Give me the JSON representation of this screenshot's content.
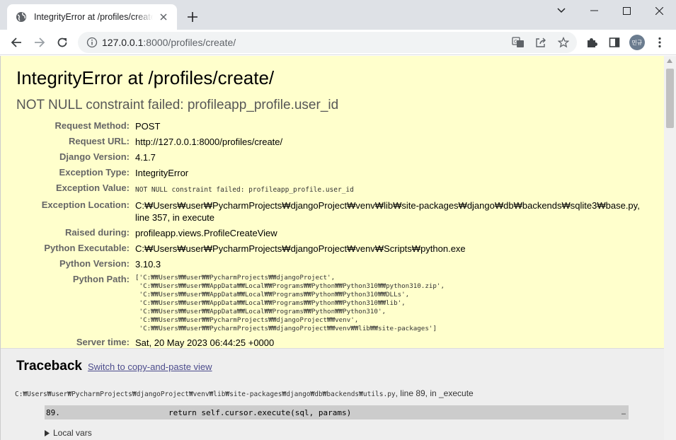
{
  "browser": {
    "tab_title": "IntegrityError at /profiles/create/",
    "url_host": "127.0.0.1",
    "url_rest": ":8000/profiles/create/",
    "avatar_text": "민규"
  },
  "error": {
    "title": "IntegrityError at /profiles/create/",
    "message": "NOT NULL constraint failed: profileapp_profile.user_id"
  },
  "meta": {
    "request_method_label": "Request Method:",
    "request_method": "POST",
    "request_url_label": "Request URL:",
    "request_url": "http://127.0.0.1:8000/profiles/create/",
    "django_version_label": "Django Version:",
    "django_version": "4.1.7",
    "exception_type_label": "Exception Type:",
    "exception_type": "IntegrityError",
    "exception_value_label": "Exception Value:",
    "exception_value": "NOT NULL constraint failed: profileapp_profile.user_id",
    "exception_location_label": "Exception Location:",
    "exception_location": "C:₩Users₩user₩PycharmProjects₩djangoProject₩venv₩lib₩site-packages₩django₩db₩backends₩sqlite3₩base.py, line 357, in execute",
    "raised_during_label": "Raised during:",
    "raised_during": "profileapp.views.ProfileCreateView",
    "python_executable_label": "Python Executable:",
    "python_executable": "C:₩Users₩user₩PycharmProjects₩djangoProject₩venv₩Scripts₩python.exe",
    "python_version_label": "Python Version:",
    "python_version": "3.10.3",
    "python_path_label": "Python Path:",
    "python_path": "['C:₩₩Users₩₩user₩₩PycharmProjects₩₩djangoProject',\n 'C:₩₩Users₩₩user₩₩AppData₩₩Local₩₩Programs₩₩Python₩₩Python310₩₩python310.zip',\n 'C:₩₩Users₩₩user₩₩AppData₩₩Local₩₩Programs₩₩Python₩₩Python310₩₩DLLs',\n 'C:₩₩Users₩₩user₩₩AppData₩₩Local₩₩Programs₩₩Python₩₩Python310₩₩lib',\n 'C:₩₩Users₩₩user₩₩AppData₩₩Local₩₩Programs₩₩Python₩₩Python310',\n 'C:₩₩Users₩₩user₩₩PycharmProjects₩₩djangoProject₩₩venv',\n 'C:₩₩Users₩₩user₩₩PycharmProjects₩₩djangoProject₩₩venv₩₩lib₩₩site-packages']",
    "server_time_label": "Server time:",
    "server_time": "Sat, 20 May 2023 06:44:25 +0000"
  },
  "traceback": {
    "heading": "Traceback",
    "switch_link": "Switch to copy-and-paste view",
    "frame_path": "C:₩Users₩user₩PycharmProjects₩djangoProject₩venv₩lib₩site-packages₩django₩db₩backends₩utils.py",
    "frame_suffix": ", line 89, in _execute",
    "line_number": "89.",
    "code": "        return self.cursor.execute(sql, params)",
    "dots": "…",
    "local_vars": "Local vars"
  },
  "icons": {
    "favicon": "globe-icon",
    "translate": "translate-icon",
    "share": "share-icon",
    "bookmark": "star-icon",
    "extensions": "puzzle-icon",
    "sidepanel": "sidepanel-icon",
    "menu": "kebab-menu-icon"
  }
}
